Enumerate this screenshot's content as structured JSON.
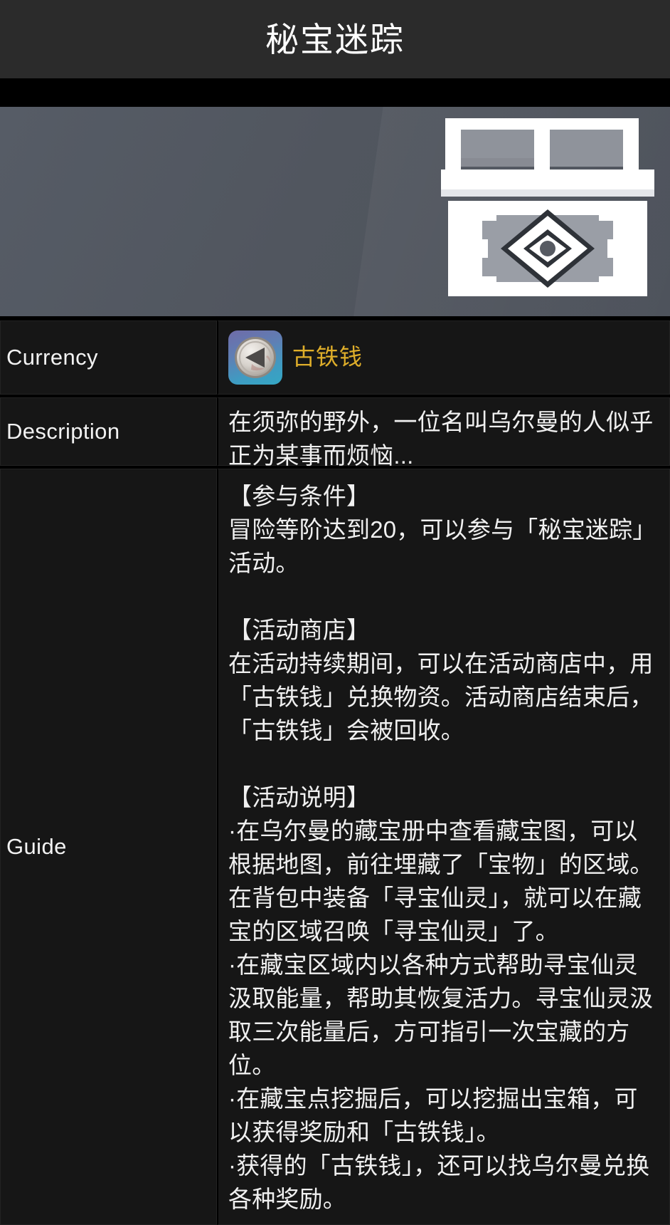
{
  "header": {
    "title": "秘宝迷踪"
  },
  "banner": {
    "icon_name": "treasure-chest-icon",
    "background_color": "#51565f"
  },
  "table": {
    "currency": {
      "label": "Currency",
      "item_name": "古铁钱",
      "item_name_color": "#dfae2a",
      "item_icon_name": "ancient-iron-coin-icon"
    },
    "description": {
      "label": "Description",
      "text": "在须弥的野外，一位名叫乌尔曼的人似乎正为某事而烦恼..."
    },
    "guide": {
      "label": "Guide",
      "text": "【参与条件】\n冒险等阶达到20，可以参与「秘宝迷踪」活动。\n\n【活动商店】\n在活动持续期间，可以在活动商店中，用「古铁钱」兑换物资。活动商店结束后，「古铁钱」会被回收。\n\n【活动说明】\n·在乌尔曼的藏宝册中查看藏宝图，可以根据地图，前往埋藏了「宝物」的区域。在背包中装备「寻宝仙灵」，就可以在藏宝的区域召唤「寻宝仙灵」了。\n·在藏宝区域内以各种方式帮助寻宝仙灵汲取能量，帮助其恢复活力。寻宝仙灵汲取三次能量后，方可指引一次宝藏的方位。\n·在藏宝点挖掘后，可以挖掘出宝箱，可以获得奖励和「古铁钱」。\n·获得的「古铁钱」，还可以找乌尔曼兑换各种奖励。"
    }
  }
}
